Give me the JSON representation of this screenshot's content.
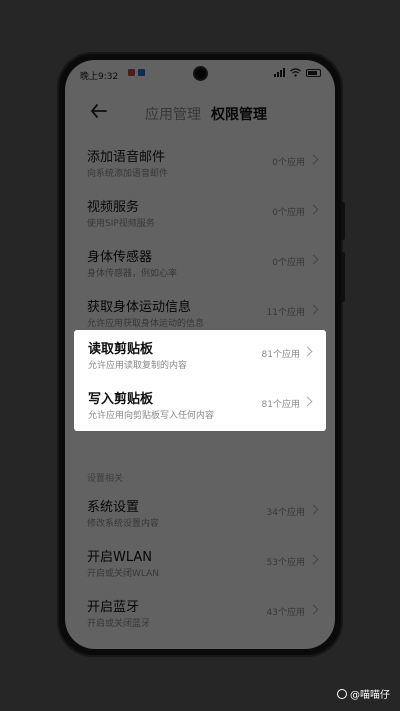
{
  "status": {
    "time": "晚上9:32",
    "mini_icons": [
      "#c44",
      "#2a6bd6"
    ]
  },
  "header": {
    "tab_app": "应用管理",
    "tab_permission": "权限管理"
  },
  "rows": [
    {
      "title": "添加语音邮件",
      "subtitle": "向系统添加语音邮件",
      "count": "0个应用"
    },
    {
      "title": "视频服务",
      "subtitle": "使用SIP视频服务",
      "count": "0个应用"
    },
    {
      "title": "身体传感器",
      "subtitle": "身体传感器，例如心率",
      "count": "0个应用"
    },
    {
      "title": "获取身体运动信息",
      "subtitle": "允许应用获取身体运动的信息",
      "count": "11个应用"
    },
    {
      "title": "读取剪贴板",
      "subtitle": "允许应用读取复制的内容",
      "count": "81个应用"
    },
    {
      "title": "写入剪贴板",
      "subtitle": "允许应用向剪贴板写入任何内容",
      "count": "81个应用"
    }
  ],
  "settings_section": {
    "header": "设置相关",
    "rows": [
      {
        "title": "系统设置",
        "subtitle": "修改系统设置内容",
        "count": "34个应用"
      },
      {
        "title": "开启WLAN",
        "subtitle": "开启或关闭WLAN",
        "count": "53个应用"
      },
      {
        "title": "开启蓝牙",
        "subtitle": "开启或关闭蓝牙",
        "count": "43个应用"
      }
    ]
  },
  "watermark": "@喵喵仔"
}
